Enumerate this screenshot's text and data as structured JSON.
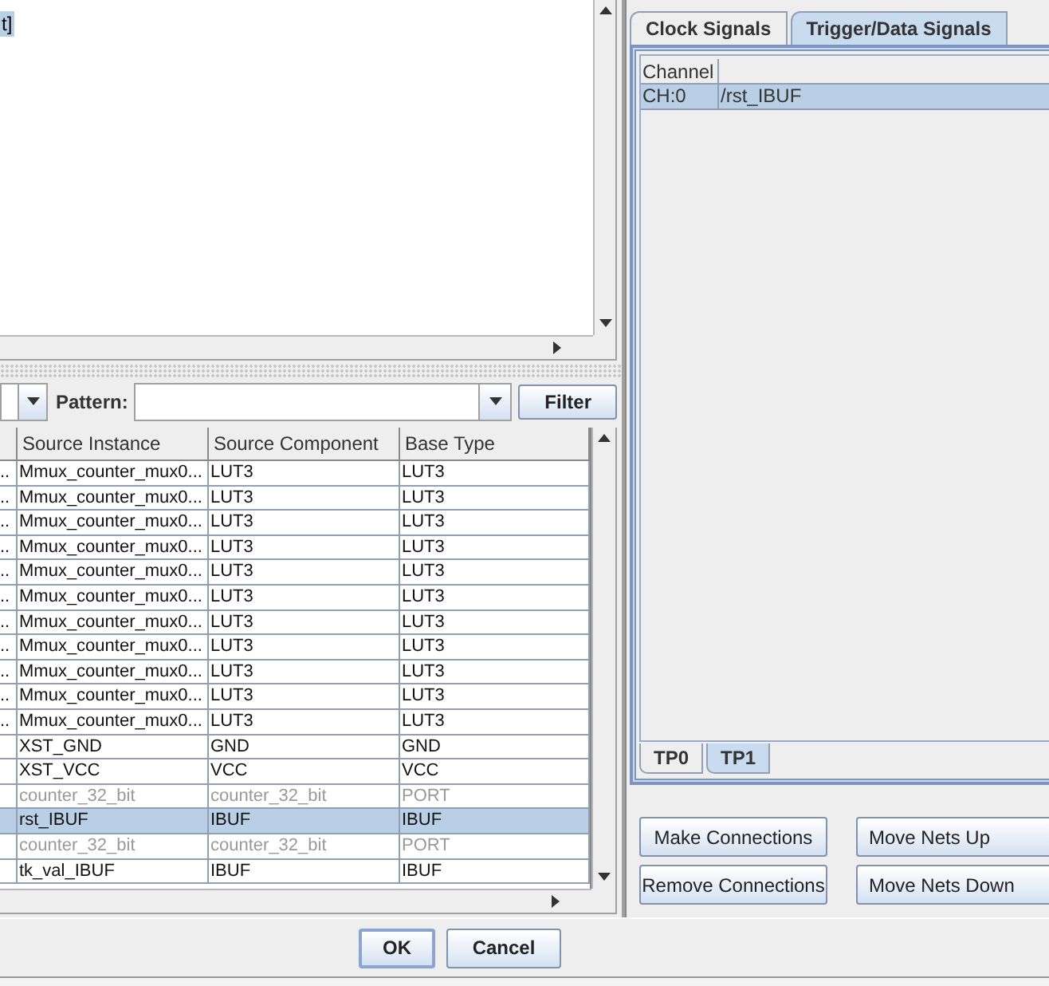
{
  "top_list": {
    "items": [
      {
        "label": "t]",
        "selected": true
      }
    ]
  },
  "filter": {
    "label": "Pattern:",
    "button": "Filter"
  },
  "table": {
    "columns": [
      "Source Instance",
      "Source Component",
      "Base Type"
    ],
    "rows": [
      {
        "column_1": "..",
        "cells": [
          "Mmux_counter_mux0...",
          "LUT3",
          "LUT3"
        ],
        "disabled": false,
        "selected": false
      },
      {
        "column_1": "..",
        "cells": [
          "Mmux_counter_mux0...",
          "LUT3",
          "LUT3"
        ],
        "disabled": false,
        "selected": false
      },
      {
        "column_1": "..",
        "cells": [
          "Mmux_counter_mux0...",
          "LUT3",
          "LUT3"
        ],
        "disabled": false,
        "selected": false
      },
      {
        "column_1": "..",
        "cells": [
          "Mmux_counter_mux0...",
          "LUT3",
          "LUT3"
        ],
        "disabled": false,
        "selected": false
      },
      {
        "column_1": "..",
        "cells": [
          "Mmux_counter_mux0...",
          "LUT3",
          "LUT3"
        ],
        "disabled": false,
        "selected": false
      },
      {
        "column_1": "..",
        "cells": [
          "Mmux_counter_mux0...",
          "LUT3",
          "LUT3"
        ],
        "disabled": false,
        "selected": false
      },
      {
        "column_1": "..",
        "cells": [
          "Mmux_counter_mux0...",
          "LUT3",
          "LUT3"
        ],
        "disabled": false,
        "selected": false
      },
      {
        "column_1": "..",
        "cells": [
          "Mmux_counter_mux0...",
          "LUT3",
          "LUT3"
        ],
        "disabled": false,
        "selected": false
      },
      {
        "column_1": "..",
        "cells": [
          "Mmux_counter_mux0...",
          "LUT3",
          "LUT3"
        ],
        "disabled": false,
        "selected": false
      },
      {
        "column_1": "..",
        "cells": [
          "Mmux_counter_mux0...",
          "LUT3",
          "LUT3"
        ],
        "disabled": false,
        "selected": false
      },
      {
        "column_1": "..",
        "cells": [
          "Mmux_counter_mux0...",
          "LUT3",
          "LUT3"
        ],
        "disabled": false,
        "selected": false
      },
      {
        "cells": [
          "XST_GND",
          "GND",
          "GND"
        ],
        "disabled": false,
        "selected": false
      },
      {
        "cells": [
          "XST_VCC",
          "VCC",
          "VCC"
        ],
        "disabled": false,
        "selected": false
      },
      {
        "cells": [
          "counter_32_bit",
          "counter_32_bit",
          "PORT"
        ],
        "disabled": true,
        "selected": false
      },
      {
        "cells": [
          "rst_IBUF",
          "IBUF",
          "IBUF"
        ],
        "disabled": false,
        "selected": true
      },
      {
        "cells": [
          "counter_32_bit",
          "counter_32_bit",
          "PORT"
        ],
        "disabled": true,
        "selected": false
      },
      {
        "cells": [
          "tk_val_IBUF",
          "IBUF",
          "IBUF"
        ],
        "disabled": false,
        "selected": false
      }
    ]
  },
  "dialog_buttons": [
    "OK",
    "Cancel"
  ],
  "signal_tabs": [
    {
      "label": "Clock Signals",
      "selected": false
    },
    {
      "label": "Trigger/Data Signals",
      "selected": true
    }
  ],
  "channel_table": {
    "columns": [
      "Channel"
    ],
    "rows": [
      {
        "cells": [
          "CH:0",
          "/rst_IBUF"
        ],
        "selected": true
      }
    ]
  },
  "port_tabs": [
    {
      "label": "TP0",
      "selected": false
    },
    {
      "label": "TP1",
      "selected": true
    }
  ],
  "connection_buttons": [
    "Make Connections",
    "Remove Connections"
  ],
  "move_buttons": [
    "Move Nets Up",
    "Move Nets Down"
  ]
}
